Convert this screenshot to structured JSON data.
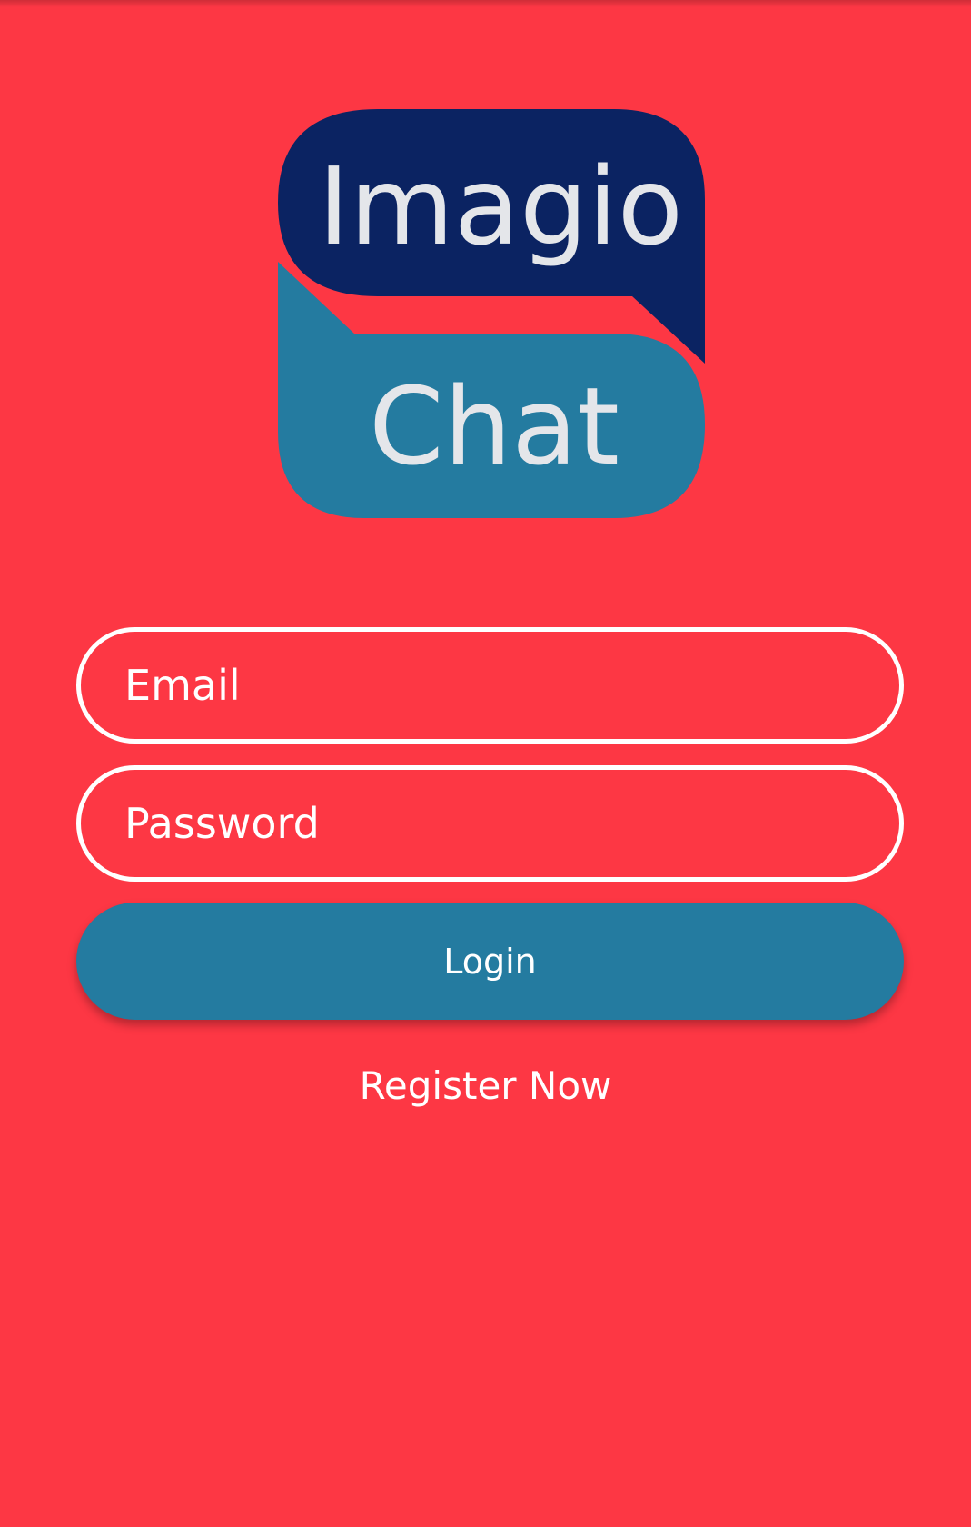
{
  "app": {
    "logo_line1": "Imagio",
    "logo_line2": "Chat"
  },
  "form": {
    "email_placeholder": "Email",
    "email_value": "",
    "password_placeholder": "Password",
    "password_value": "",
    "login_label": "Login",
    "register_label": "Register Now"
  },
  "colors": {
    "background": "#FD3744",
    "logo_top_bubble": "#0B2362",
    "logo_bottom_bubble": "#247BA0",
    "login_button": "#247BA0",
    "logo_text": "#E4E6EA"
  }
}
